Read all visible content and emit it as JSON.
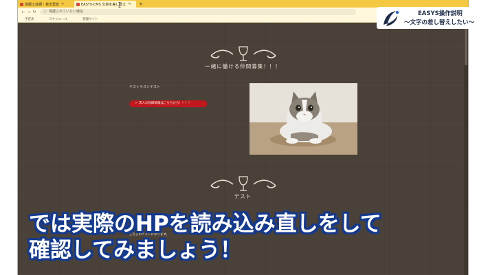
{
  "browser": {
    "tabs": [
      {
        "label": "情報工芸網・貸出雲管"
      },
      {
        "label": "EASYS-CMS 文章を差し替え"
      }
    ],
    "new_tab_label": "+",
    "address": "保護されていない通信",
    "bookmarks": [
      "予定表",
      "スケジュール",
      "管理サイト"
    ]
  },
  "page": {
    "section1": {
      "title": "一緒に働ける仲間募集！！！",
      "text": "テストテストテスト",
      "apply_button": "＞ 求人の詳細情報はこちらから！！！！"
    },
    "section2": {
      "title": "テスト",
      "text": "こちらのテストになります。"
    }
  },
  "overlay": {
    "logo_line1": "EASYS操作説明",
    "logo_line2": "〜文字の差し替えしたい〜",
    "subtitle_line1": "では実際のHPを読み込み直しをして",
    "subtitle_line2": "確認してみましょう！"
  },
  "colors": {
    "tabbar": "#f5c842",
    "page_bg": "#4a4139",
    "button_red": "#c0181c",
    "subtitle_outline": "#143a8f",
    "logo_text": "#1f2d4a"
  }
}
